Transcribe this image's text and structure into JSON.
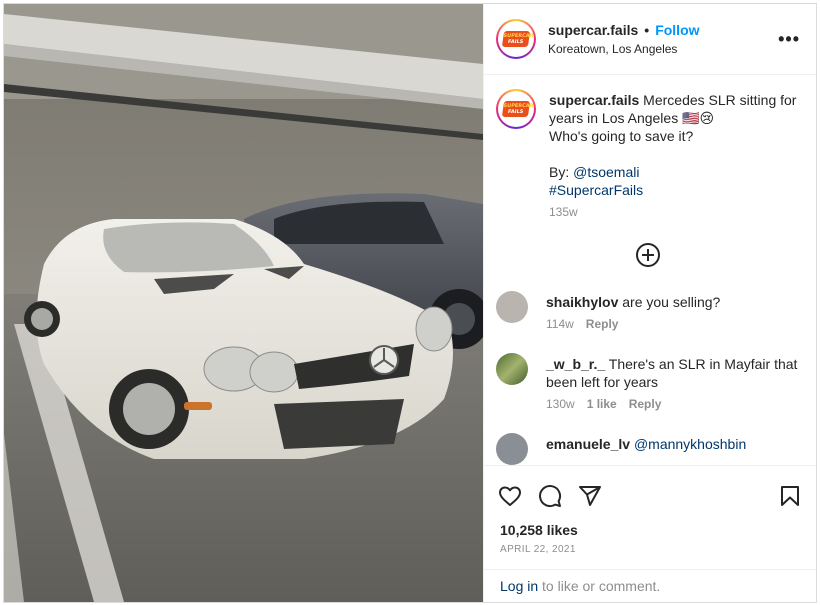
{
  "post": {
    "username": "supercar.fails",
    "follow_label": "Follow",
    "location": "Koreatown, Los Angeles",
    "more_label": "•••",
    "avatar_badge": [
      "SUPERCAR",
      "FAILS"
    ]
  },
  "caption": {
    "username": "supercar.fails",
    "line1": "Mercedes SLR sitting for years in Los Angeles",
    "emoji": "🇺🇸😢",
    "line2": "Who's going to save it?",
    "by_label": "By:",
    "by_handle": "@tsoemali",
    "hashtag": "#SupercarFails",
    "age": "135w"
  },
  "comments": [
    {
      "username": "shaikhylov",
      "text": "are you selling?",
      "age": "114w",
      "likes": "",
      "reply": "Reply",
      "avatar_color": "#b9b4ad"
    },
    {
      "username": "_w_b_r._",
      "text": "There's an SLR in Mayfair that been left for years",
      "age": "130w",
      "likes": "1 like",
      "reply": "Reply",
      "avatar_color": "#6f8a4a"
    },
    {
      "username": "emanuele_lv",
      "text": "@mannykhoshbin",
      "age": "",
      "likes": "",
      "reply": "",
      "avatar_color": "#8a8f95"
    }
  ],
  "likes": "10,258 likes",
  "date": "APRIL 22, 2021",
  "login": {
    "link": "Log in",
    "rest": " to like or comment."
  },
  "icons": [
    "heart-icon",
    "comment-icon",
    "share-icon",
    "bookmark-icon",
    "add-comment-icon"
  ],
  "colors": {
    "accent": "#0095f6",
    "link": "#00376b",
    "muted": "#8e8e8e"
  }
}
